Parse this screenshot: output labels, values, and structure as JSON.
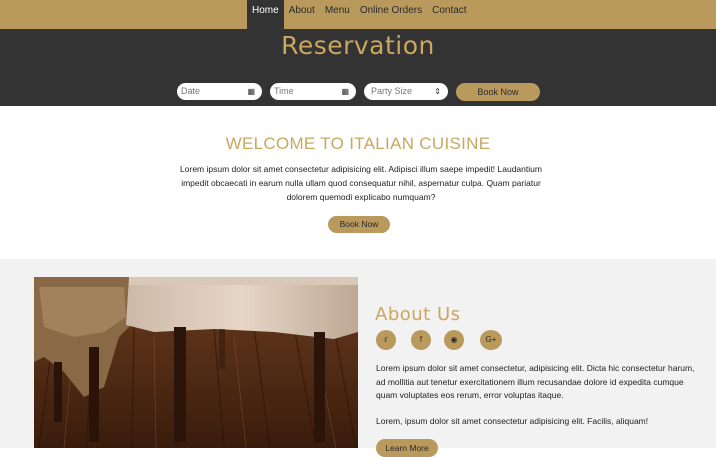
{
  "nav": {
    "items": [
      "Home",
      "About",
      "Menu",
      "Online Orders",
      "Contact"
    ]
  },
  "hero": {
    "title": "Reservation",
    "date_placeholder": "Date",
    "time_placeholder": "Time",
    "party_size": "Party Size",
    "book_label": "Book Now"
  },
  "welcome": {
    "title": "WELCOME TO ITALIAN CUISINE",
    "body": "Lorem ipsum dolor sit amet consectetur adipisicing elit. Adipisci illum saepe impedit! Laudantium impedit obcaecati in earum nulla ullam quod consequatur nihil, aspernatur culpa. Quam pariatur dolorem quemodi explicabo numquam?",
    "book_label": "Book Now"
  },
  "about": {
    "title": "About Us",
    "social": [
      "twitter-icon",
      "facebook-icon",
      "dribbble-icon",
      "google-plus-icon"
    ],
    "para1": "Lorem ipsum dolor sit amet consectetur, adipisicing elit. Dicta hic consectetur harum, ad mollitia aut tenetur exercitationem illum recusandae dolore id expedita cumque quam voluptates eos rerum, error voluptas itaque.",
    "para2": "Lorem, ipsum dolor sit amet consectetur adipisicing elit. Facilis, aliquam!",
    "learn_label": "Learn More"
  }
}
